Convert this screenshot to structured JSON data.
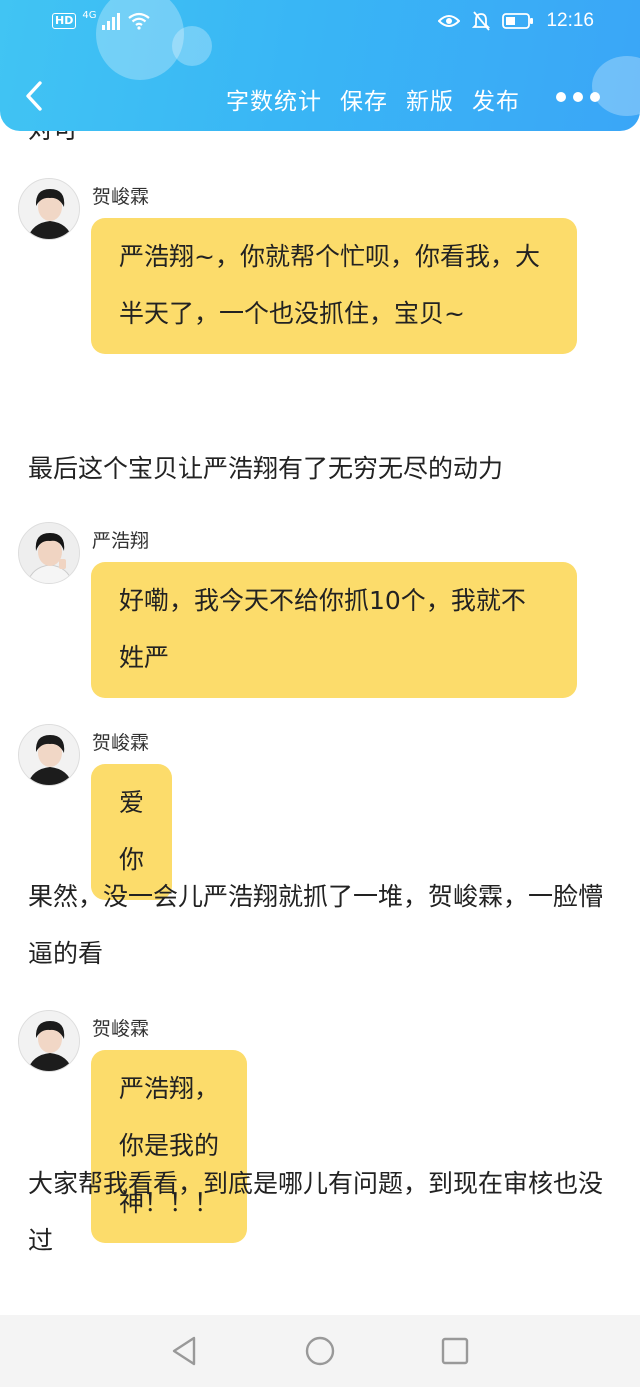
{
  "status_bar": {
    "hd": "HD",
    "signal_label": "4G",
    "time": "12:16",
    "icons": [
      "signal-icon",
      "wifi-icon",
      "eye-icon",
      "mute-icon",
      "battery-icon"
    ]
  },
  "toolbar": {
    "back_icon": "chevron-left-icon",
    "word_count": "字数统计",
    "save": "保存",
    "new_version": "新版",
    "publish": "发布",
    "more_icon": "more-dots-icon"
  },
  "colors": {
    "header": "#3ab5f5",
    "bubble": "#fcdc6b"
  },
  "messages": [
    {
      "sender": "贺峻霖",
      "text": "严浩翔~，你就帮个忙呗，你看我，大半天了，一个也没抓住，宝贝~"
    },
    {
      "sender": "严浩翔",
      "text": "好嘞，我今天不给你抓10个，我就不姓严"
    },
    {
      "sender": "贺峻霖",
      "text": "爱你"
    },
    {
      "sender": "贺峻霖",
      "text": "严浩翔，你是我的神！！！"
    }
  ],
  "paragraphs": [
    "最后这个宝贝让严浩翔有了无穷无尽的动力",
    "果然，没一会儿严浩翔就抓了一堆，贺峻霖，一脸懵逼的看",
    "大家帮我看看，到底是哪儿有问题，到现在审核也没过"
  ],
  "system_nav": [
    "back-triangle-icon",
    "home-circle-icon",
    "recents-square-icon"
  ]
}
